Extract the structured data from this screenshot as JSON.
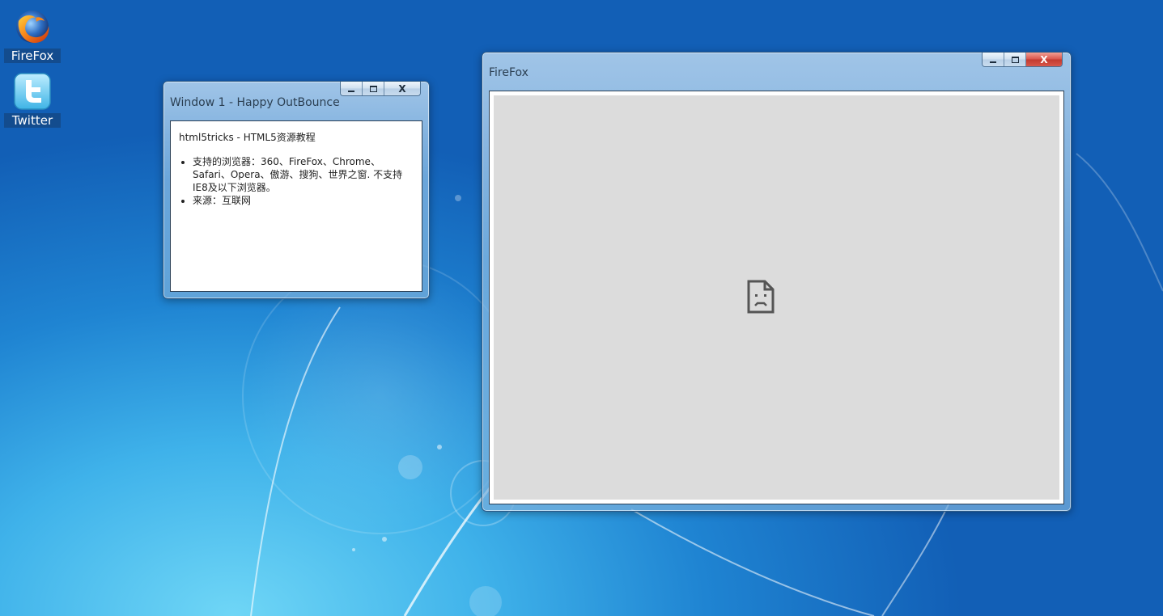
{
  "desktop": {
    "icons": [
      {
        "label": "FireFox",
        "icon": "firefox-icon"
      },
      {
        "label": "Twitter",
        "icon": "twitter-icon"
      }
    ]
  },
  "window1": {
    "title": "Window 1 - Happy OutBounce",
    "heading": "html5tricks - HTML5资源教程",
    "list": [
      "支持的浏览器：360、FireFox、Chrome、Safari、Opera、傲游、搜狗、世界之窗. 不支持IE8及以下浏览器。",
      "来源：互联网"
    ],
    "buttons": {
      "minimize": "minimize",
      "maximize": "maximize",
      "close": "X"
    }
  },
  "firefox_window": {
    "title": "FireFox",
    "buttons": {
      "minimize": "minimize",
      "maximize": "maximize",
      "close": "X"
    },
    "content_icon": "sad-document-icon"
  },
  "colors": {
    "desktop_blue": "#1f84d2",
    "error_gray": "#dcdcdc",
    "close_red": "#d9534a"
  }
}
